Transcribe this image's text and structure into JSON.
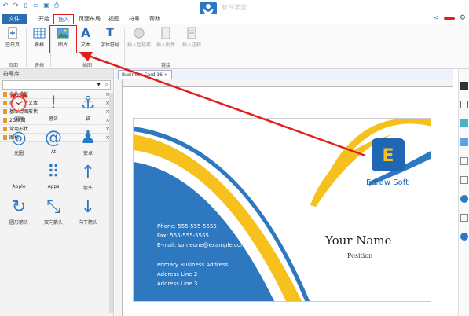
{
  "app": {
    "title_watermark": "软件学堂"
  },
  "menubar": {
    "file": "文件",
    "items": [
      "开始",
      "插入",
      "页面布局",
      "视图",
      "符号",
      "帮助"
    ]
  },
  "ribbon": {
    "buttons": [
      {
        "label": "空白页",
        "icon": "blank-page-icon"
      },
      {
        "label": "表格",
        "icon": "table-icon"
      },
      {
        "label": "图片",
        "icon": "picture-icon"
      },
      {
        "label": "文本",
        "icon": "text-icon"
      },
      {
        "label": "字体符号",
        "icon": "font-symbol-icon"
      },
      {
        "label": "插入超链接",
        "icon": "hyperlink-icon"
      },
      {
        "label": "插入附件",
        "icon": "attachment-icon"
      },
      {
        "label": "插入注释",
        "icon": "note-icon"
      }
    ],
    "groups": [
      "页面",
      "表格",
      "插图",
      "链接"
    ]
  },
  "sidebar": {
    "title": "符号库",
    "libraries": [
      "名片模板",
      "商业卡片文本",
      "基本绘图形状",
      "2D框图",
      "常用形状",
      "图标"
    ],
    "icons": [
      {
        "label": "闹钟",
        "glyph": "⏰"
      },
      {
        "label": "警告",
        "glyph": "!"
      },
      {
        "label": "锚",
        "glyph": "⚓"
      },
      {
        "label": "光圈",
        "glyph": "◎"
      },
      {
        "label": "At",
        "glyph": "@"
      },
      {
        "label": "安卓",
        "glyph": "♟"
      },
      {
        "label": "Apple",
        "glyph": ""
      },
      {
        "label": "Apps",
        "glyph": "⠿"
      },
      {
        "label": "箭头",
        "glyph": "↑"
      },
      {
        "label": "圆形箭头",
        "glyph": "↻"
      },
      {
        "label": "双向箭头",
        "glyph": "⤡"
      },
      {
        "label": "向下箭头",
        "glyph": "↓"
      }
    ]
  },
  "document": {
    "tab": "Business Card 16",
    "card": {
      "phone": "Phone: 555-555-5555",
      "fax": "Fax: 555-555-5555",
      "email": "E-mail: someone@example.com",
      "address_title": "Primary Business Address",
      "address2": "Address Line 2",
      "address3": "Address Line 3",
      "name": "Your Name",
      "position": "Position",
      "company": "Edraw Soft"
    }
  },
  "colors": {
    "accent": "#2b78c5",
    "file_tab": "#2b6cb3",
    "highlight": "#e0201c",
    "card_blue": "#2e78c0",
    "card_yellow": "#f6c11d"
  }
}
